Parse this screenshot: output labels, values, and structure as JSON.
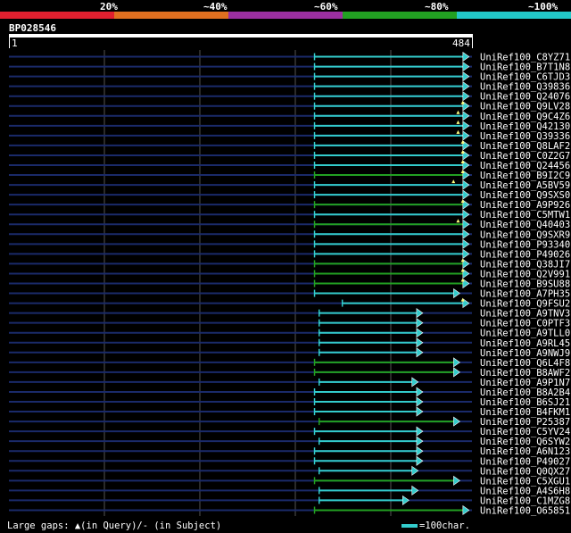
{
  "legend": {
    "labels": [
      "20%",
      "~40%",
      "~60%",
      "~80%",
      "~100%"
    ],
    "colors": [
      "#e0202f",
      "#e07020",
      "#9b2fa0",
      "#22a022",
      "#22c8c8"
    ]
  },
  "query": {
    "id": "BP028546",
    "start": "1",
    "end": "484",
    "length": 484
  },
  "hits": [
    {
      "name": "UniRef100_C8YZ71",
      "qs": 0.66,
      "qe": 0.99,
      "color": "#33cccc",
      "gap": null
    },
    {
      "name": "UniRef100_B7T1N8",
      "qs": 0.66,
      "qe": 0.99,
      "color": "#33cccc",
      "gap": null
    },
    {
      "name": "UniRef100_C6TJD3",
      "qs": 0.66,
      "qe": 0.99,
      "color": "#33cccc",
      "gap": null
    },
    {
      "name": "UniRef100_Q39836",
      "qs": 0.66,
      "qe": 0.99,
      "color": "#33cccc",
      "gap": null
    },
    {
      "name": "UniRef100_Q24076",
      "qs": 0.66,
      "qe": 0.99,
      "color": "#33cccc",
      "gap": null
    },
    {
      "name": "UniRef100_Q9LV28",
      "qs": 0.66,
      "qe": 0.99,
      "color": "#33cccc",
      "gap": 0.98
    },
    {
      "name": "UniRef100_Q9C4Z6",
      "qs": 0.66,
      "qe": 0.99,
      "color": "#33cccc",
      "gap": 0.97
    },
    {
      "name": "UniRef100_Q42130",
      "qs": 0.66,
      "qe": 0.99,
      "color": "#33cccc",
      "gap": 0.97
    },
    {
      "name": "UniRef100_Q39336",
      "qs": 0.66,
      "qe": 0.99,
      "color": "#33cccc",
      "gap": 0.97
    },
    {
      "name": "UniRef100_Q8LAF2",
      "qs": 0.66,
      "qe": 0.99,
      "color": "#33cccc",
      "gap": 0.98
    },
    {
      "name": "UniRef100_C0Z2G7",
      "qs": 0.66,
      "qe": 0.99,
      "color": "#33cccc",
      "gap": 0.98
    },
    {
      "name": "UniRef100_Q24456",
      "qs": 0.66,
      "qe": 0.99,
      "color": "#33cccc",
      "gap": 0.98
    },
    {
      "name": "UniRef100_B9I2C9",
      "qs": 0.66,
      "qe": 0.99,
      "color": "#22a022",
      "gap": 0.98
    },
    {
      "name": "UniRef100_A5BV59",
      "qs": 0.66,
      "qe": 0.99,
      "color": "#33cccc",
      "gap": 0.96
    },
    {
      "name": "UniRef100_Q9SXS0",
      "qs": 0.66,
      "qe": 0.99,
      "color": "#33cccc",
      "gap": null
    },
    {
      "name": "UniRef100_A9P926",
      "qs": 0.66,
      "qe": 0.99,
      "color": "#22a022",
      "gap": 0.98
    },
    {
      "name": "UniRef100_C5MTW1",
      "qs": 0.66,
      "qe": 0.99,
      "color": "#33cccc",
      "gap": null
    },
    {
      "name": "UniRef100_Q40403",
      "qs": 0.66,
      "qe": 0.99,
      "color": "#22a022",
      "gap": 0.97
    },
    {
      "name": "UniRef100_Q9SXR9",
      "qs": 0.66,
      "qe": 0.99,
      "color": "#33cccc",
      "gap": null
    },
    {
      "name": "UniRef100_P93340",
      "qs": 0.66,
      "qe": 0.99,
      "color": "#33cccc",
      "gap": null
    },
    {
      "name": "UniRef100_P49026",
      "qs": 0.66,
      "qe": 0.99,
      "color": "#33cccc",
      "gap": null
    },
    {
      "name": "UniRef100_Q38JI7",
      "qs": 0.66,
      "qe": 0.99,
      "color": "#22a022",
      "gap": 0.98
    },
    {
      "name": "UniRef100_Q2V991",
      "qs": 0.66,
      "qe": 0.99,
      "color": "#22a022",
      "gap": 0.98
    },
    {
      "name": "UniRef100_B9SU88",
      "qs": 0.66,
      "qe": 0.99,
      "color": "#22a022",
      "gap": 0.98
    },
    {
      "name": "UniRef100_A7PH35",
      "qs": 0.66,
      "qe": 0.97,
      "color": "#33cccc",
      "gap": null
    },
    {
      "name": "UniRef100_Q9FSU2",
      "qs": 0.72,
      "qe": 0.99,
      "color": "#33cccc",
      "gap": 0.98
    },
    {
      "name": "UniRef100_A9TNV3",
      "qs": 0.67,
      "qe": 0.89,
      "color": "#33cccc",
      "gap": null
    },
    {
      "name": "UniRef100_C0PTF3",
      "qs": 0.67,
      "qe": 0.89,
      "color": "#33cccc",
      "gap": null
    },
    {
      "name": "UniRef100_A9TLL0",
      "qs": 0.67,
      "qe": 0.89,
      "color": "#33cccc",
      "gap": null
    },
    {
      "name": "UniRef100_A9RL45",
      "qs": 0.67,
      "qe": 0.89,
      "color": "#33cccc",
      "gap": null
    },
    {
      "name": "UniRef100_A9NWJ9",
      "qs": 0.67,
      "qe": 0.89,
      "color": "#33cccc",
      "gap": null
    },
    {
      "name": "UniRef100_Q6L4F8",
      "qs": 0.66,
      "qe": 0.97,
      "color": "#22a022",
      "gap": null
    },
    {
      "name": "UniRef100_B8AWF2",
      "qs": 0.66,
      "qe": 0.97,
      "color": "#22a022",
      "gap": null
    },
    {
      "name": "UniRef100_A9P1N7",
      "qs": 0.67,
      "qe": 0.88,
      "color": "#33cccc",
      "gap": null
    },
    {
      "name": "UniRef100_B8A2B4",
      "qs": 0.66,
      "qe": 0.89,
      "color": "#33cccc",
      "gap": null
    },
    {
      "name": "UniRef100_B6SJ21",
      "qs": 0.66,
      "qe": 0.89,
      "color": "#33cccc",
      "gap": null
    },
    {
      "name": "UniRef100_B4FKM1",
      "qs": 0.66,
      "qe": 0.89,
      "color": "#33cccc",
      "gap": null
    },
    {
      "name": "UniRef100_P25387",
      "qs": 0.67,
      "qe": 0.97,
      "color": "#22a022",
      "gap": null
    },
    {
      "name": "UniRef100_C5YV24",
      "qs": 0.66,
      "qe": 0.89,
      "color": "#33cccc",
      "gap": null
    },
    {
      "name": "UniRef100_Q6SYW2",
      "qs": 0.67,
      "qe": 0.89,
      "color": "#33cccc",
      "gap": null
    },
    {
      "name": "UniRef100_A6N123",
      "qs": 0.66,
      "qe": 0.89,
      "color": "#33cccc",
      "gap": null
    },
    {
      "name": "UniRef100_P49027",
      "qs": 0.66,
      "qe": 0.89,
      "color": "#33cccc",
      "gap": null
    },
    {
      "name": "UniRef100_Q0QX27",
      "qs": 0.67,
      "qe": 0.88,
      "color": "#33cccc",
      "gap": null
    },
    {
      "name": "UniRef100_C5XGU1",
      "qs": 0.66,
      "qe": 0.97,
      "color": "#22a022",
      "gap": null
    },
    {
      "name": "UniRef100_A4S6H8",
      "qs": 0.67,
      "qe": 0.88,
      "color": "#33cccc",
      "gap": null
    },
    {
      "name": "UniRef100_C1MZG8",
      "qs": 0.67,
      "qe": 0.86,
      "color": "#33cccc",
      "gap": null
    },
    {
      "name": "UniRef100_O65851",
      "qs": 0.66,
      "qe": 0.99,
      "color": "#22a022",
      "gap": null
    }
  ],
  "footer": {
    "gaps_label": "Large gaps: ▲(in Query)/- (in Subject)",
    "scale_label": "=100char."
  }
}
